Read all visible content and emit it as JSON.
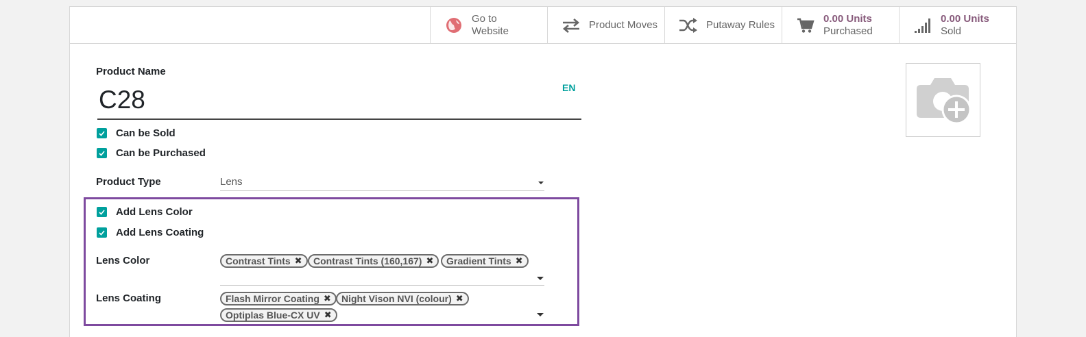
{
  "buttons": {
    "website": {
      "line1": "Go to",
      "line2": "Website"
    },
    "moves": {
      "label": "Product Moves"
    },
    "putaway": {
      "label": "Putaway Rules"
    },
    "purchased": {
      "value": "0.00 Units",
      "sub": "Purchased"
    },
    "sold": {
      "value": "0.00 Units",
      "sub": "Sold"
    }
  },
  "form": {
    "product_name_label": "Product Name",
    "product_name_value": "C28",
    "lang": "EN",
    "can_be_sold": "Can be Sold",
    "can_be_purchased": "Can be Purchased",
    "product_type_label": "Product Type",
    "product_type_value": "Lens",
    "add_lens_color": "Add Lens Color",
    "add_lens_coating": "Add Lens Coating",
    "lens_color_label": "Lens Color",
    "lens_color_tags": [
      "Contrast Tints",
      "Contrast Tints (160,167)",
      "Gradient Tints"
    ],
    "lens_coating_label": "Lens Coating",
    "lens_coating_tags": [
      "Flash Mirror Coating",
      "Night Vison NVI (colour)",
      "Optiplas Blue-CX UV"
    ],
    "tag_remove": "✖"
  },
  "colors": {
    "accent": "#00A09D",
    "brand": "#875a7b",
    "highlight": "#7e4a9f"
  }
}
